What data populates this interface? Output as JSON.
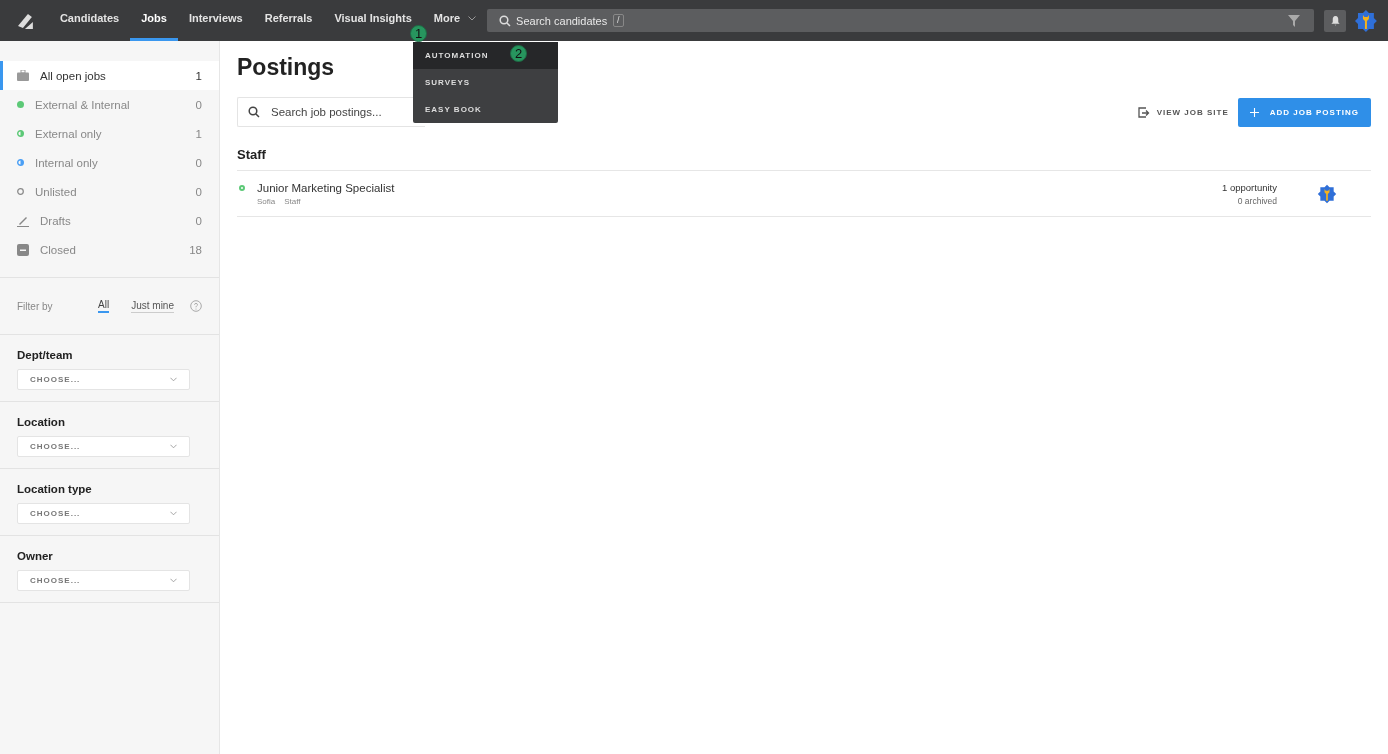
{
  "nav": {
    "items": [
      {
        "label": "Candidates",
        "selected": false
      },
      {
        "label": "Jobs",
        "selected": true
      },
      {
        "label": "Interviews",
        "selected": false
      },
      {
        "label": "Referrals",
        "selected": false
      },
      {
        "label": "Visual Insights",
        "selected": false
      },
      {
        "label": "More",
        "selected": false
      }
    ],
    "search": {
      "placeholder": "Search candidates",
      "shortcut": "/"
    }
  },
  "more_menu": {
    "items": [
      {
        "label": "AUTOMATION",
        "selected": true
      },
      {
        "label": "SURVEYS",
        "selected": false
      },
      {
        "label": "EASY BOOK",
        "selected": false
      }
    ]
  },
  "annotations": [
    {
      "label": "1"
    },
    {
      "label": "2"
    }
  ],
  "sidebar": {
    "items": [
      {
        "kind": "group",
        "label": "All open jobs",
        "count": "1",
        "selected": true
      },
      {
        "kind": "dot",
        "color": "#5cc977",
        "label": "External & Internal",
        "count": "0",
        "selected": false
      },
      {
        "kind": "half",
        "color": "#5cc977",
        "label": "External only",
        "count": "1",
        "selected": false
      },
      {
        "kind": "half",
        "color": "#4a9ff5",
        "label": "Internal only",
        "count": "0",
        "selected": false
      },
      {
        "kind": "ring",
        "color": "#888888",
        "label": "Unlisted",
        "count": "0",
        "selected": false
      },
      {
        "kind": "group",
        "label": "Drafts",
        "count": "0",
        "selected": false
      },
      {
        "kind": "group",
        "label": "Closed",
        "count": "18",
        "selected": false
      }
    ],
    "filter": {
      "label": "Filter by",
      "options": [
        {
          "label": "All",
          "selected": true
        },
        {
          "label": "Just mine",
          "selected": false
        }
      ]
    },
    "filters": [
      {
        "label": "Dept/team",
        "placeholder": "CHOOSE..."
      },
      {
        "label": "Location",
        "placeholder": "CHOOSE..."
      },
      {
        "label": "Location type",
        "placeholder": "CHOOSE..."
      },
      {
        "label": "Owner",
        "placeholder": "CHOOSE..."
      }
    ]
  },
  "main": {
    "title": "Postings",
    "search": {
      "placeholder": "Search job postings..."
    },
    "view_site": "VIEW JOB SITE",
    "add_button": "ADD JOB POSTING",
    "groups": [
      {
        "title": "Staff",
        "postings": [
          {
            "title": "Junior Marketing Specialist",
            "color": "#5cc977",
            "location": "Sofia",
            "team": "Staff",
            "opportunities": "1 opportunity",
            "archived": "0 archived"
          }
        ]
      }
    ]
  }
}
